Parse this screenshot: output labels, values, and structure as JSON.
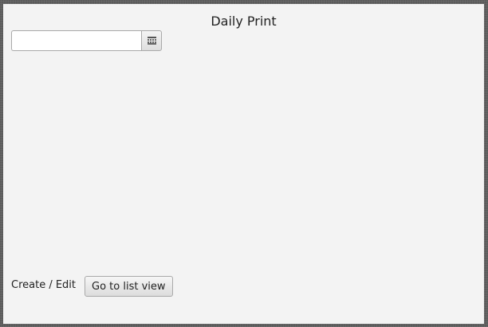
{
  "header": {
    "title": "Daily Print"
  },
  "date_picker": {
    "value": "",
    "placeholder": "",
    "button_icon": "calendar-icon"
  },
  "footer": {
    "mode_label": "Create / Edit",
    "list_view_button": "Go to list view"
  }
}
